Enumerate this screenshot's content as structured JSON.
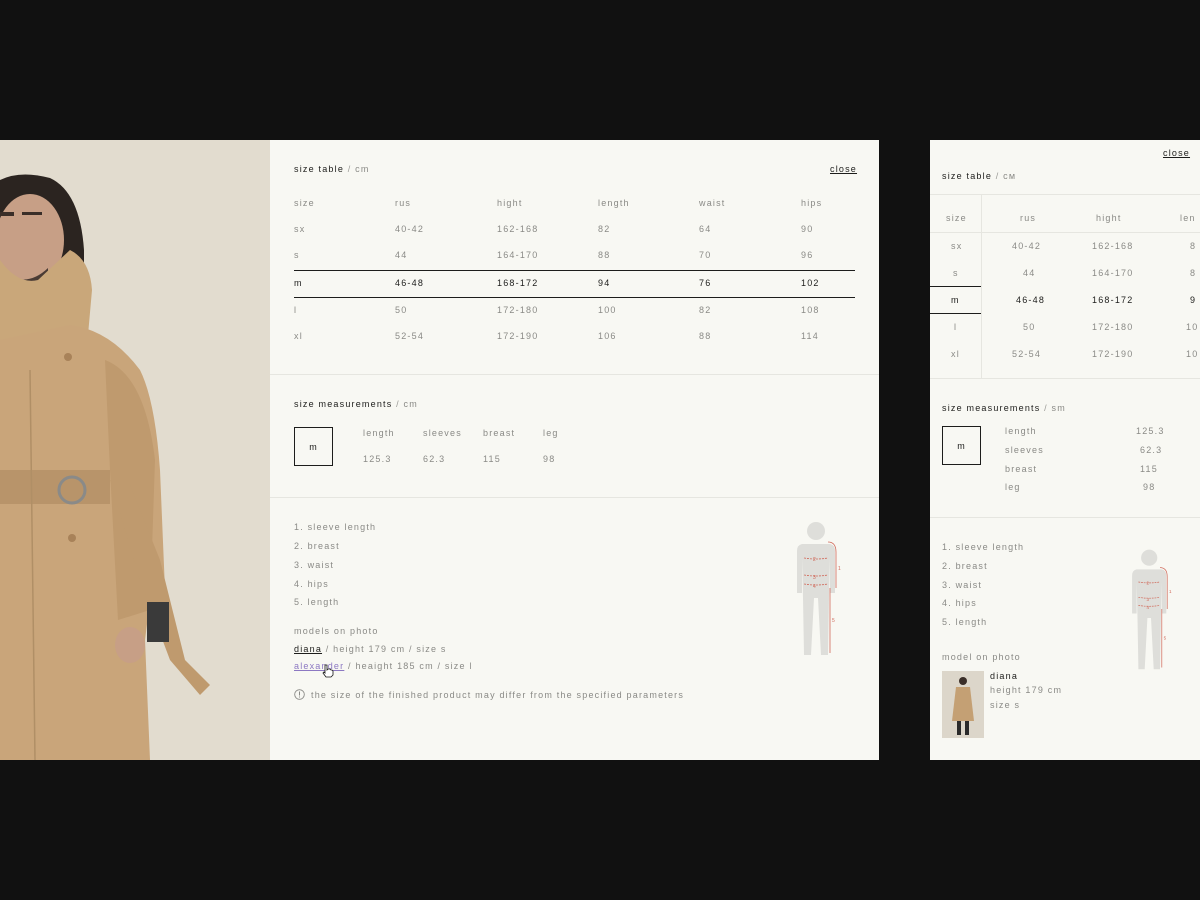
{
  "size_table": {
    "title": "size table",
    "unit": "cm",
    "close_label": "close",
    "columns": [
      "size",
      "rus",
      "hight",
      "length",
      "waist",
      "hips"
    ],
    "rows": [
      [
        "sx",
        "40-42",
        "162-168",
        "82",
        "64",
        "90"
      ],
      [
        "s",
        "44",
        "164-170",
        "88",
        "70",
        "96"
      ],
      [
        "m",
        "46-48",
        "168-172",
        "94",
        "76",
        "102"
      ],
      [
        "l",
        "50",
        "172-180",
        "100",
        "82",
        "108"
      ],
      [
        "xl",
        "52-54",
        "172-190",
        "106",
        "88",
        "114"
      ]
    ],
    "selected_size": "m"
  },
  "size_measurements": {
    "title": "size measurements",
    "unit": "cm",
    "selected_size": "m",
    "labels": [
      "length",
      "sleeves",
      "breast",
      "leg"
    ],
    "values": [
      "125.3",
      "62.3",
      "115",
      "98"
    ]
  },
  "legend": {
    "items": [
      "1. sleeve length",
      "2. breast",
      "3. waist",
      "4. hips",
      "5. length"
    ]
  },
  "models": {
    "title": "models on photo",
    "list": [
      {
        "name": "diana",
        "details": "/ height 179 cm / size s"
      },
      {
        "name": "alexander",
        "details": "/ heaight 185 cm / size l"
      }
    ]
  },
  "note": "the size of the finished product may differ from the specified parameters",
  "figure_labels": [
    "1",
    "2",
    "3",
    "4",
    "5"
  ],
  "mobile": {
    "close_label": "close",
    "size_table_title": "size table",
    "size_table_unit": "см",
    "columns": [
      "size",
      "rus",
      "hight",
      "len"
    ],
    "rows": [
      [
        "sx",
        "40-42",
        "162-168",
        "8"
      ],
      [
        "s",
        "44",
        "164-170",
        "8"
      ],
      [
        "m",
        "46-48",
        "168-172",
        "9"
      ],
      [
        "l",
        "50",
        "172-180",
        "10"
      ],
      [
        "xl",
        "52-54",
        "172-190",
        "10"
      ]
    ],
    "measurements_title": "size measurements",
    "measurements_unit": "sm",
    "selected_size": "m",
    "measurements": [
      {
        "label": "length",
        "value": "125.3"
      },
      {
        "label": "sleeves",
        "value": "62.3"
      },
      {
        "label": "breast",
        "value": "115"
      },
      {
        "label": "leg",
        "value": "98"
      }
    ],
    "legend": [
      "1. sleeve length",
      "2. breast",
      "3. waist",
      "4. hips",
      "5. length"
    ],
    "model_title": "model on photo",
    "model_name": "diana",
    "model_height": "height 179 cm",
    "model_size": "size s"
  },
  "colors": {
    "background": "#111111",
    "panel": "#f8f8f3",
    "accent_link": "#8c78c2",
    "figure_marks": "#d0695a",
    "coat": "#c9a77a"
  }
}
